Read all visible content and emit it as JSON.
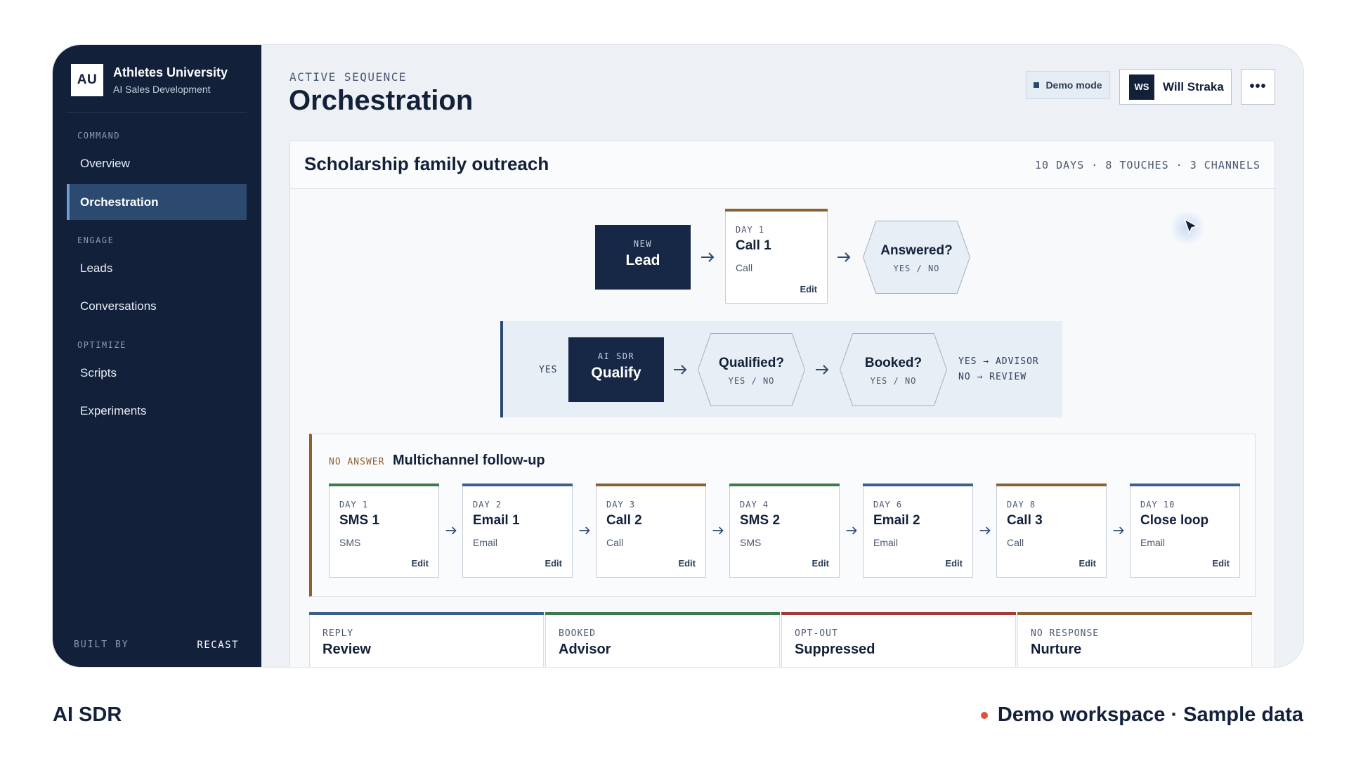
{
  "brand": {
    "logo": "AU",
    "name": "Athletes University",
    "subtitle": "AI Sales Development"
  },
  "sidebar": {
    "sections": [
      {
        "label": "COMMAND",
        "items": [
          {
            "label": "Overview"
          },
          {
            "label": "Orchestration",
            "active": true
          }
        ]
      },
      {
        "label": "ENGAGE",
        "items": [
          {
            "label": "Leads"
          },
          {
            "label": "Conversations"
          }
        ]
      },
      {
        "label": "OPTIMIZE",
        "items": [
          {
            "label": "Scripts"
          },
          {
            "label": "Experiments"
          }
        ]
      }
    ],
    "footer_left": "BUILT BY",
    "footer_right": "RECAST"
  },
  "header": {
    "eyebrow": "ACTIVE SEQUENCE",
    "title": "Orchestration",
    "demo_mode": "Demo mode",
    "user_initials": "WS",
    "user_name": "Will Straka",
    "more_icon": "ellipsis-icon"
  },
  "sequence": {
    "title": "Scholarship family outreach",
    "meta": "10 DAYS · 8 TOUCHES · 3 CHANNELS",
    "lead_node": {
      "label": "NEW",
      "title": "Lead"
    },
    "first_call": {
      "day": "DAY 1",
      "name": "Call 1",
      "channel": "Call",
      "edit": "Edit"
    },
    "answered": {
      "question": "Answered?",
      "options": "YES / NO"
    },
    "qualify_branch": {
      "yes_label": "YES",
      "node": {
        "label": "AI SDR",
        "title": "Qualify"
      },
      "qualified": {
        "question": "Qualified?",
        "options": "YES / NO"
      },
      "booked": {
        "question": "Booked?",
        "options": "YES / NO"
      },
      "outcome_yes": "YES → ADVISOR",
      "outcome_no": "NO → REVIEW"
    },
    "followup": {
      "tag": "NO ANSWER",
      "title": "Multichannel follow-up",
      "steps": [
        {
          "day": "DAY 1",
          "name": "SMS 1",
          "channel": "SMS",
          "edit": "Edit"
        },
        {
          "day": "DAY 2",
          "name": "Email 1",
          "channel": "Email",
          "edit": "Edit"
        },
        {
          "day": "DAY 3",
          "name": "Call 2",
          "channel": "Call",
          "edit": "Edit"
        },
        {
          "day": "DAY 4",
          "name": "SMS 2",
          "channel": "SMS",
          "edit": "Edit"
        },
        {
          "day": "DAY 6",
          "name": "Email 2",
          "channel": "Email",
          "edit": "Edit"
        },
        {
          "day": "DAY 8",
          "name": "Call 3",
          "channel": "Call",
          "edit": "Edit"
        },
        {
          "day": "DAY 10",
          "name": "Close loop",
          "channel": "Email",
          "edit": "Edit"
        }
      ]
    },
    "outcomes": [
      {
        "label": "REPLY",
        "title": "Review"
      },
      {
        "label": "BOOKED",
        "title": "Advisor"
      },
      {
        "label": "OPT-OUT",
        "title": "Suppressed"
      },
      {
        "label": "NO RESPONSE",
        "title": "Nurture"
      }
    ]
  },
  "colors": {
    "call": "#8a6232",
    "sms": "#3f7a4f",
    "email": "#3d5f8c",
    "optout": "#a53a3a",
    "accent": "#2c4a70"
  },
  "footer": {
    "left": "AI SDR",
    "right": "Demo workspace · Sample data"
  }
}
